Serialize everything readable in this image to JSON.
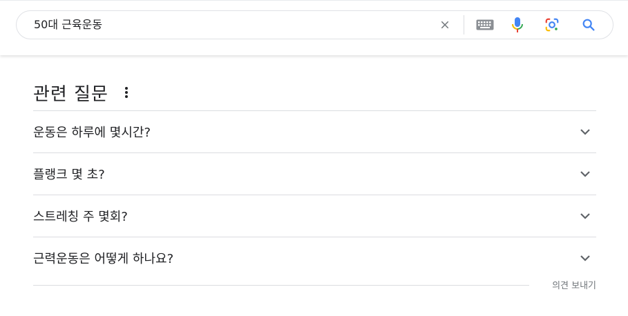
{
  "search": {
    "query": "50대 근육운동",
    "icons": [
      "close-icon",
      "keyboard-icon",
      "mic-icon",
      "lens-icon",
      "search-icon"
    ]
  },
  "paa": {
    "title": "관련 질문",
    "questions": [
      "운동은 하루에 몇시간?",
      "플랭크 몇 초?",
      "스트레칭 주 몇회?",
      "근력운동은 어떻게 하나요?"
    ],
    "feedback_label": "의견 보내기"
  },
  "colors": {
    "text": "#202124",
    "muted": "#70757a",
    "divider": "#dadce0",
    "google_blue": "#4285f4",
    "google_red": "#ea4335",
    "google_yellow": "#fbbc04",
    "google_green": "#34a853"
  }
}
